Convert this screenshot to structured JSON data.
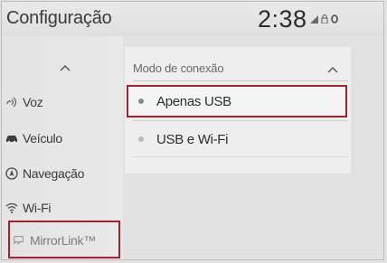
{
  "header": {
    "title": "Configuração",
    "clock": "2:38",
    "status_icons": [
      "signal-icon",
      "lock-icon",
      "settings-dot-icon"
    ]
  },
  "sidebar": {
    "items": [
      {
        "label": "Voz",
        "icon": "voice-icon"
      },
      {
        "label": "Veículo",
        "icon": "car-icon"
      },
      {
        "label": "Navegação",
        "icon": "navigation-icon"
      },
      {
        "label": "Wi-Fi",
        "icon": "wifi-icon"
      },
      {
        "label": "MirrorLink™",
        "icon": "mirrorlink-icon"
      }
    ]
  },
  "panel": {
    "title": "Modo de conexão",
    "options": [
      {
        "label": "Apenas USB",
        "selected": true
      },
      {
        "label": "USB e Wi-Fi",
        "selected": false
      }
    ]
  },
  "colors": {
    "highlight": "#a4222c",
    "background": "#e2e2e2"
  }
}
